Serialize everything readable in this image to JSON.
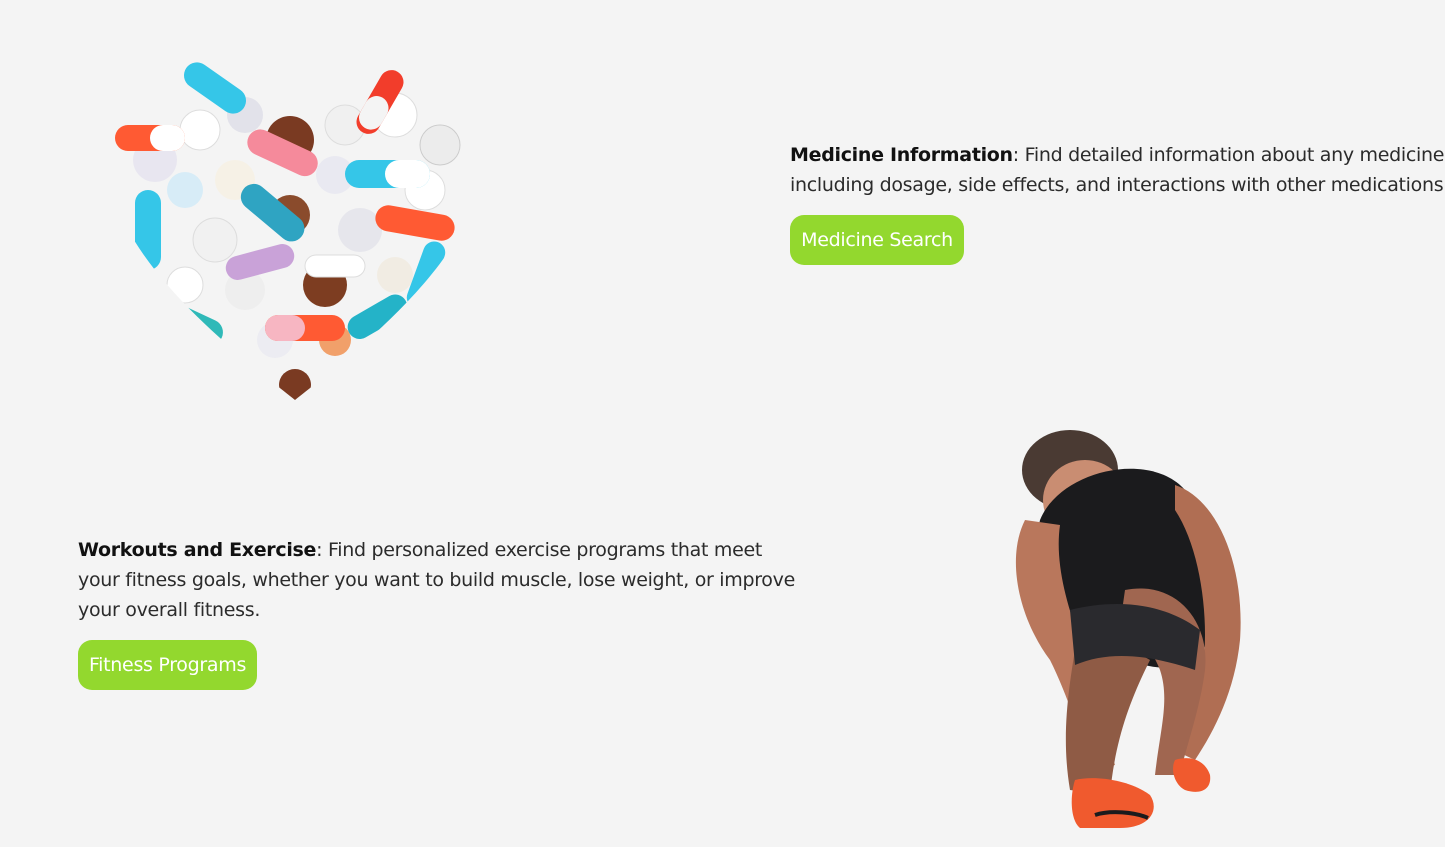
{
  "medicine": {
    "title": "Medicine Information",
    "description": ": Find detailed information about any medicine, including dosage, side effects, and interactions with other medications.",
    "button_label": "Medicine Search",
    "image_name": "pills-heart-image"
  },
  "fitness": {
    "title": "Workouts and Exercise",
    "description": ": Find personalized exercise programs that meet your fitness goals, whether you want to build muscle, lose weight, or improve your overall fitness.",
    "button_label": "Fitness Programs",
    "image_name": "athlete-tying-shoe-image"
  },
  "colors": {
    "background": "#f4f4f4",
    "accent_button": "#93d82e",
    "text": "#2b2b2b"
  }
}
